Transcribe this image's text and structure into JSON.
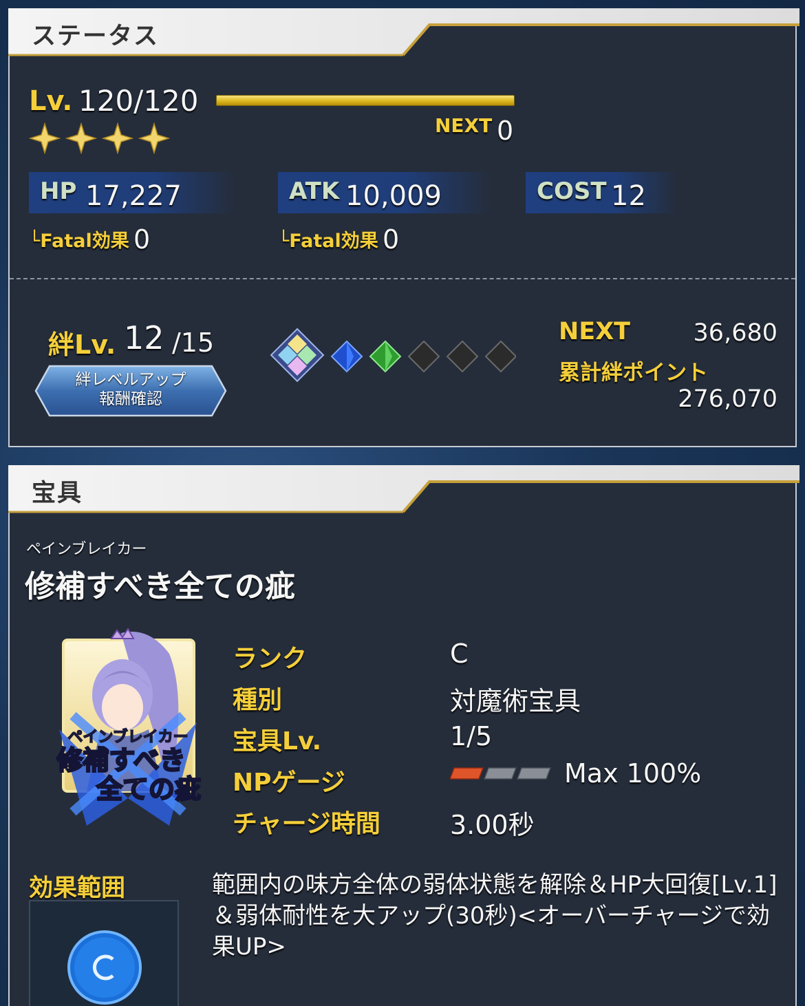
{
  "status_panel": {
    "title": "ステータス",
    "level_label": "Lv.",
    "level_value": "120/120",
    "exp_progress": 1.0,
    "rarity_stars": 4,
    "next_label": "NEXT",
    "next_value": "0",
    "hp": {
      "label": "HP",
      "value": "17,227",
      "fatal_label": "└Fatal効果",
      "fatal_value": "0"
    },
    "atk": {
      "label": "ATK",
      "value": "10,009",
      "fatal_label": "└Fatal効果",
      "fatal_value": "0"
    },
    "cost": {
      "label": "COST",
      "value": "12"
    },
    "bond": {
      "label": "絆Lv.",
      "level": "12",
      "max": "/15",
      "button_line1": "絆レベルアップ",
      "button_line2": "報酬確認",
      "next_label": "NEXT",
      "next_value": "36,680",
      "total_label": "累計絆ポイント",
      "total_value": "276,070"
    }
  },
  "np_panel": {
    "title": "宝具",
    "ruby": "ペインブレイカー",
    "name": "修補すべき全ての疵",
    "rows": [
      {
        "label": "ランク",
        "value": "C"
      },
      {
        "label": "種別",
        "value": "対魔術宝具"
      },
      {
        "label": "宝具Lv.",
        "value": "1/5"
      },
      {
        "label": "NPゲージ",
        "value": "Max 100%"
      },
      {
        "label": "チャージ時間",
        "value": "3.00秒"
      }
    ],
    "np_gauge_filled": 1,
    "np_gauge_total": 3,
    "range_label": "効果範囲",
    "effect_text": "範囲内の味方全体の弱体状態を解除＆HP大回復[Lv.1]＆弱体耐性を大アップ(30秒)<オーバーチャージで効果UP>"
  },
  "colors": {
    "panel_bg": "#252d3b",
    "gold_text": "#f5cf3a",
    "stat_box": "#1f3d78",
    "exp_bar": "#e0bd28"
  }
}
